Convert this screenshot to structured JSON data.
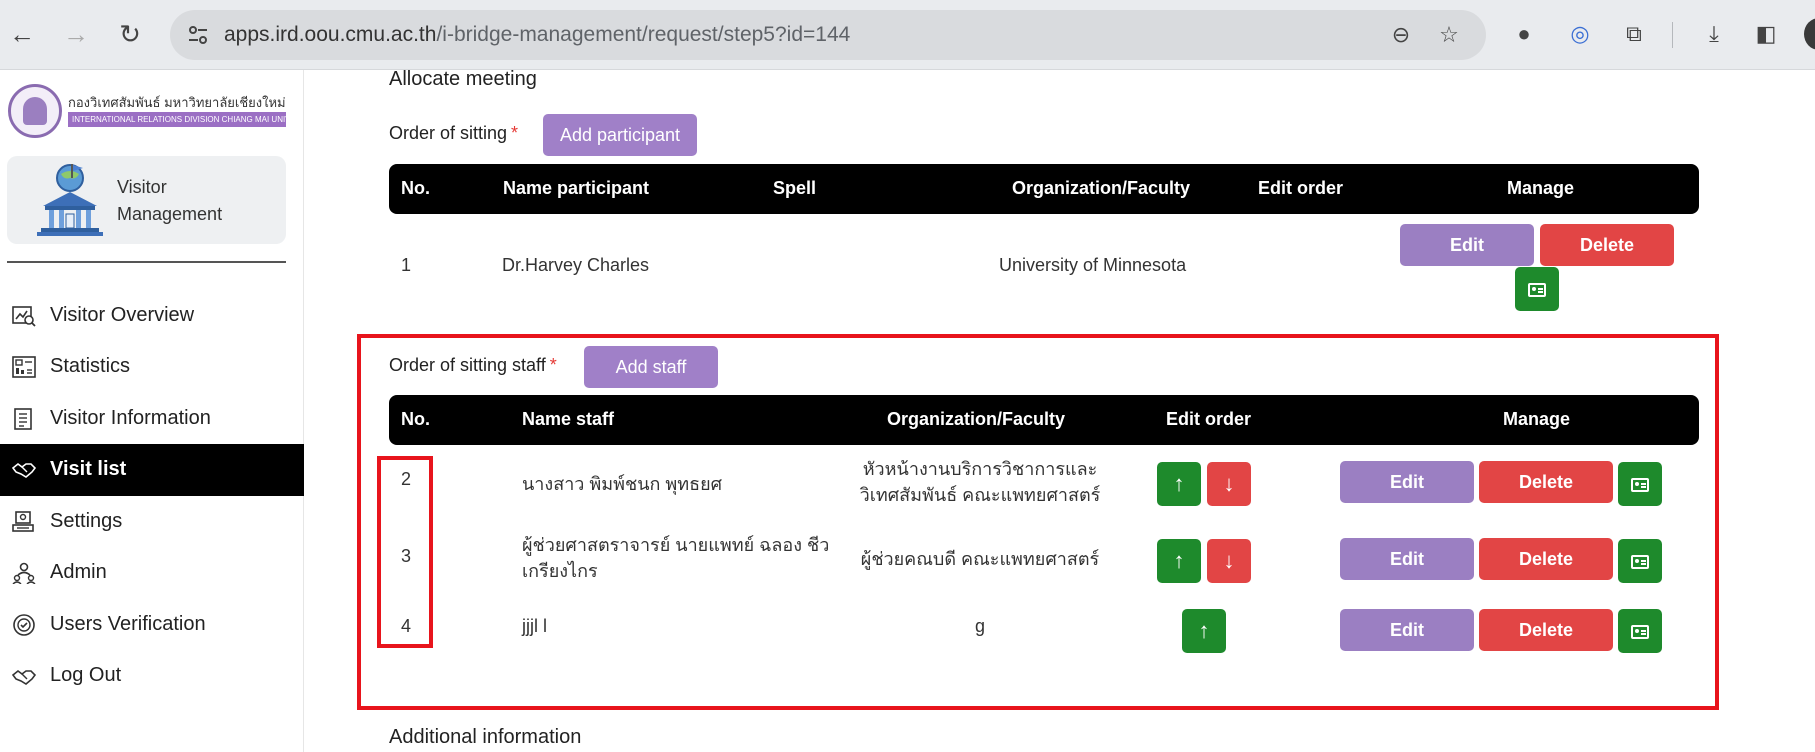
{
  "browser": {
    "url_host": "apps.ird.oou.cmu.ac.th",
    "url_path": "/i-bridge-management/request/step5?id=144"
  },
  "sidebar": {
    "logo_th": "กองวิเทศสัมพันธ์ มหาวิทยาลัยเชียงใหม่",
    "logo_en": "INTERNATIONAL RELATIONS DIVISION CHIANG MAI UNIVERSITY",
    "card_title": "Visitor Management",
    "items": [
      {
        "label": "Visitor Overview",
        "icon": "chart-search-icon"
      },
      {
        "label": "Statistics",
        "icon": "statistics-icon"
      },
      {
        "label": "Visitor Information",
        "icon": "document-list-icon"
      },
      {
        "label": "Visit list",
        "icon": "handshake-icon",
        "active": true
      },
      {
        "label": "Settings",
        "icon": "settings-icon"
      },
      {
        "label": "Admin",
        "icon": "admin-icon"
      },
      {
        "label": "Users Verification",
        "icon": "verification-icon"
      },
      {
        "label": "Log Out",
        "icon": "logout-icon"
      }
    ]
  },
  "main": {
    "allocate_title": "Allocate meeting",
    "participants": {
      "label": "Order of sitting",
      "required_mark": "*",
      "add_button": "Add participant",
      "headers": [
        "No.",
        "Name participant",
        "Spell",
        "Organization/Faculty",
        "Edit order",
        "Manage"
      ],
      "rows": [
        {
          "no": "1",
          "name": "Dr.Harvey Charles",
          "spell": "",
          "organization": "University of Minnesota"
        }
      ]
    },
    "staff": {
      "label": "Order of sitting staff",
      "required_mark": "*",
      "add_button": "Add staff",
      "headers": [
        "No.",
        "Name staff",
        "Organization/Faculty",
        "Edit order",
        "Manage"
      ],
      "rows": [
        {
          "no": "2",
          "name": "นางสาว พิมพ์ชนก พุทธยศ",
          "organization": "หัวหน้างานบริการวิชาการและวิเทศสัมพันธ์ คณะแพทยศาสตร์"
        },
        {
          "no": "3",
          "name": "ผู้ช่วยศาสตราจารย์ นายแพทย์ ฉลอง ชีวเกรียงไกร",
          "organization": "ผู้ช่วยคณบดี คณะแพทยศาสตร์"
        },
        {
          "no": "4",
          "name": "jjjl l",
          "organization": "g"
        }
      ]
    },
    "edit_label": "Edit",
    "delete_label": "Delete",
    "up_arrow": "↑",
    "down_arrow": "↓",
    "additional_title": "Additional information"
  },
  "colors": {
    "purple": "#9b7fc2",
    "red": "#e24545",
    "green": "#1e8a2c",
    "highlight": "#e8141c"
  }
}
